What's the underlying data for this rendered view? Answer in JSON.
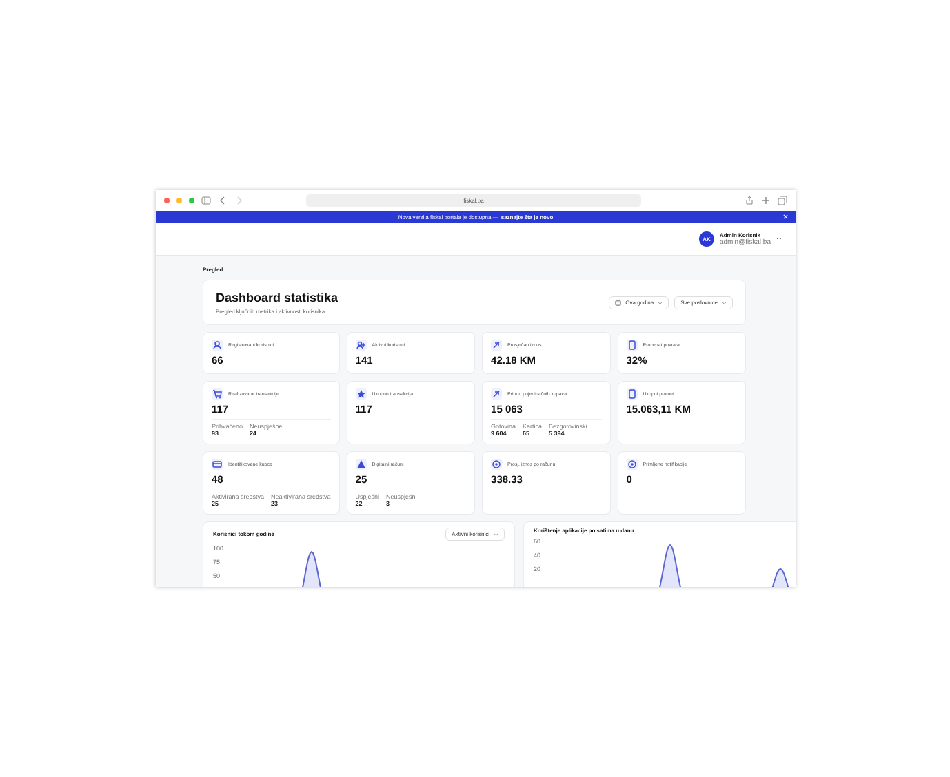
{
  "browser": {
    "url": "fiskal.ba"
  },
  "banner": {
    "text": "Nova verzija fiskal portala je dostupna —",
    "link": "saznajte šta je novo"
  },
  "user": {
    "initials": "AK",
    "name": "Admin Korisnik",
    "email": "admin@fiskal.ba"
  },
  "breadcrumb": "Pregled",
  "header": {
    "title": "Dashboard statistika",
    "subtitle": "Pregled ključnih metrika i aktivnosti korisnika",
    "filters": [
      {
        "label": "Ova godina",
        "kind": "date"
      },
      {
        "label": "Sve poslovnice",
        "kind": "plain"
      }
    ]
  },
  "stats": [
    {
      "label": "Registrovani korisnici",
      "value": "66"
    },
    {
      "label": "Aktivni korisnici",
      "value": "141"
    },
    {
      "label": "Prosječan iznos",
      "value": "42.18 KM"
    },
    {
      "label": "Procenat povrata",
      "value": "32%"
    },
    {
      "label": "Realizovane transakcije",
      "value": "117",
      "subs": [
        {
          "label": "Prihvaćeno",
          "value": "93"
        },
        {
          "label": "Neuspješne",
          "value": "24"
        }
      ]
    },
    {
      "label": "Ukupno transakcija",
      "value": "117"
    },
    {
      "label": "Prihod pojedinačnih kupaca",
      "value": "15 063",
      "subs": [
        {
          "label": "Gotovina",
          "value": "9 604"
        },
        {
          "label": "Kartica",
          "value": "65"
        },
        {
          "label": "Bezgotovinski",
          "value": "5 394"
        }
      ]
    },
    {
      "label": "Ukupni promet",
      "value": "15.063,11 KM"
    },
    {
      "label": "Identifikovane kupce",
      "value": "48",
      "subs": [
        {
          "label": "Aktivirana sredstva",
          "value": "25"
        },
        {
          "label": "Neaktivirana sredstva",
          "value": "23"
        }
      ]
    },
    {
      "label": "Digitalni računi",
      "value": "25",
      "subs": [
        {
          "label": "Uspješni",
          "value": "22"
        },
        {
          "label": "Neuspješni",
          "value": "3"
        }
      ]
    },
    {
      "label": "Prosj. iznos po računu",
      "value": "338.33"
    },
    {
      "label": "Primljene notifikacije",
      "value": "0"
    }
  ],
  "charts": [
    {
      "title": "Korisnici tokom godine",
      "dropdown": "Aktivni korisnici",
      "y_labels": [
        "100",
        "75",
        "50"
      ]
    },
    {
      "title": "Korištenje aplikacije po satima u danu",
      "y_labels": [
        "60",
        "40",
        "20"
      ]
    }
  ]
}
